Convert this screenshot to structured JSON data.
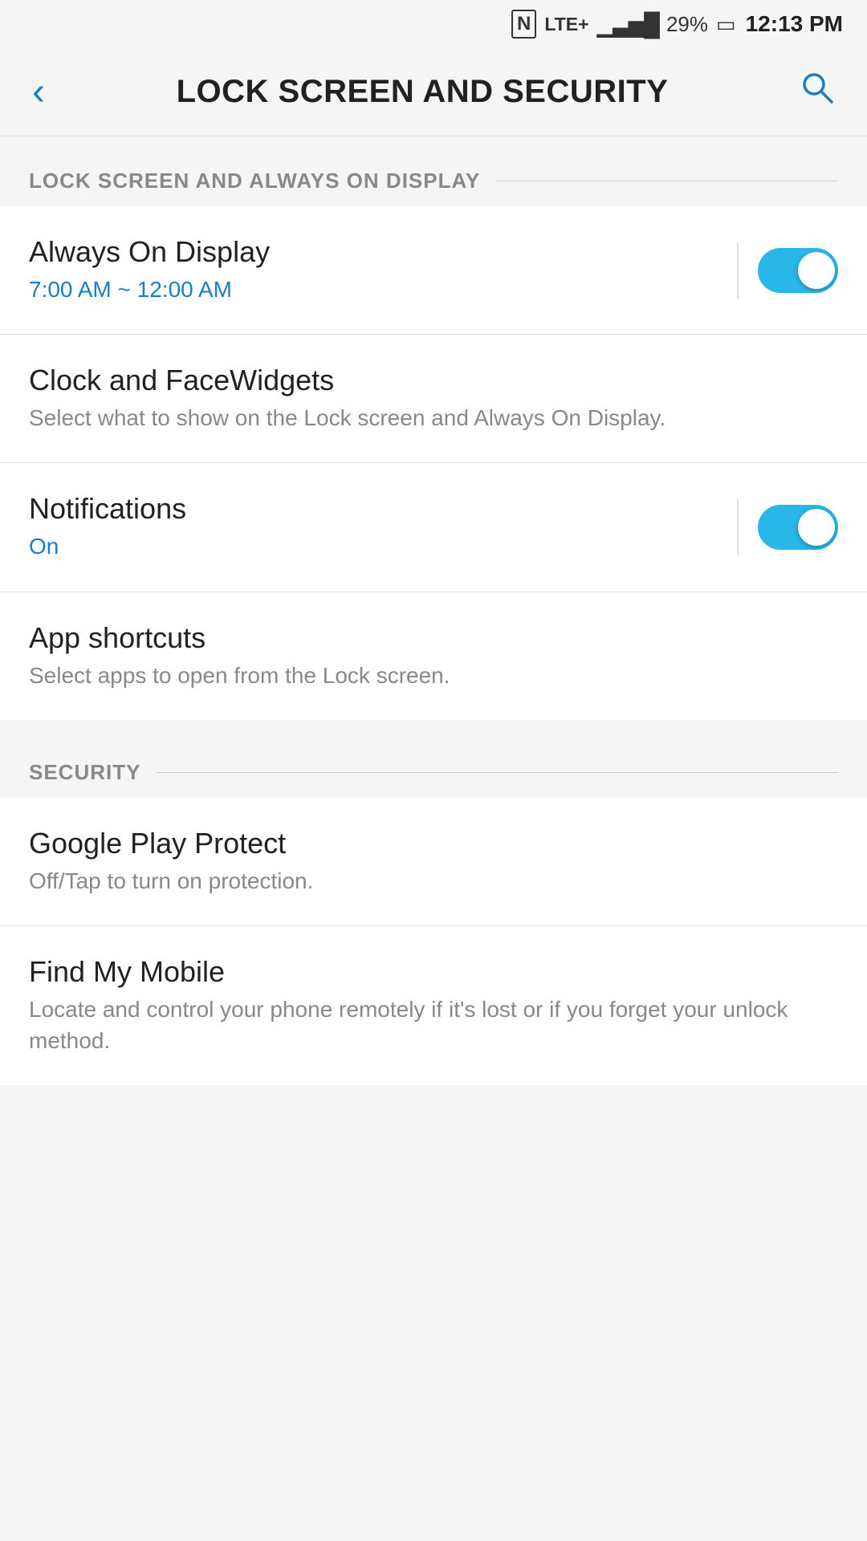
{
  "status_bar": {
    "nfc_icon": "N",
    "lte_text": "LTE+",
    "signal_bars": "▂▄▆█",
    "battery_percent": "29%",
    "battery_icon": "🔋",
    "time": "12:13 PM"
  },
  "app_bar": {
    "back_icon": "‹",
    "title": "LOCK SCREEN AND SECURITY",
    "search_icon": "⌕"
  },
  "sections": [
    {
      "id": "lock_screen_section",
      "header": "LOCK SCREEN AND ALWAYS ON DISPLAY",
      "items": [
        {
          "id": "always_on_display",
          "title": "Always On Display",
          "subtitle": "7:00 AM ~ 12:00 AM",
          "subtitle_color": "blue",
          "has_toggle": true,
          "toggle_state": "on"
        },
        {
          "id": "clock_facewidgets",
          "title": "Clock and FaceWidgets",
          "subtitle": "Select what to show on the Lock screen and Always On Display.",
          "subtitle_color": "gray",
          "has_toggle": false
        },
        {
          "id": "notifications",
          "title": "Notifications",
          "subtitle": "On",
          "subtitle_color": "blue",
          "has_toggle": true,
          "toggle_state": "on"
        },
        {
          "id": "app_shortcuts",
          "title": "App shortcuts",
          "subtitle": "Select apps to open from the Lock screen.",
          "subtitle_color": "gray",
          "has_toggle": false
        }
      ]
    },
    {
      "id": "security_section",
      "header": "SECURITY",
      "items": [
        {
          "id": "google_play_protect",
          "title": "Google Play Protect",
          "subtitle": "Off/Tap to turn on protection.",
          "subtitle_color": "gray",
          "has_toggle": false
        },
        {
          "id": "find_my_mobile",
          "title": "Find My Mobile",
          "subtitle": "Locate and control your phone remotely if it's lost or if you forget your unlock method.",
          "subtitle_color": "gray",
          "has_toggle": false
        }
      ]
    }
  ]
}
